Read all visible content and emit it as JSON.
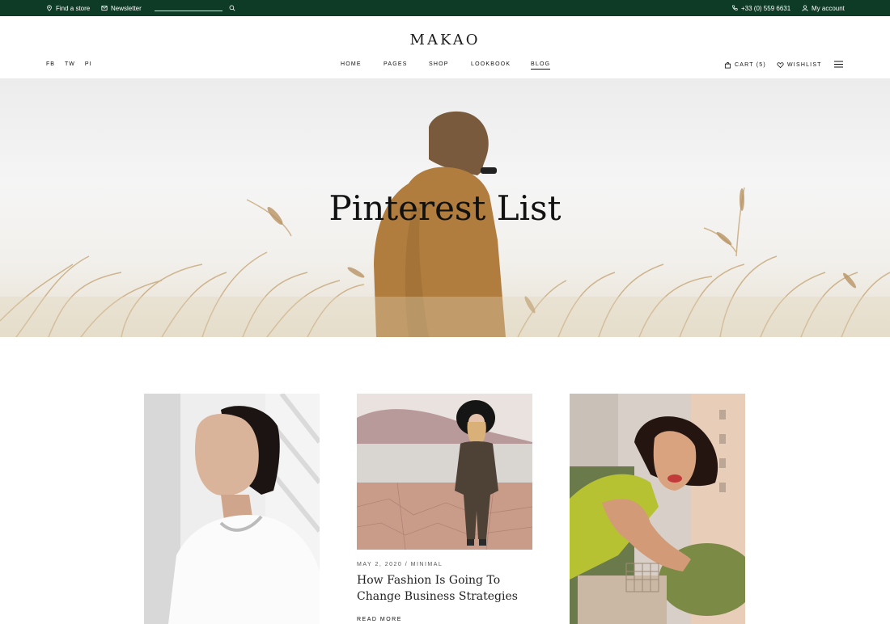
{
  "topbar": {
    "find_store": "Find a store",
    "newsletter": "Newsletter",
    "phone": "+33 (0) 559 6631",
    "account": "My account"
  },
  "header": {
    "logo": "MAKAO",
    "social": [
      "FB",
      "TW",
      "PI"
    ],
    "nav": [
      "HOME",
      "PAGES",
      "SHOP",
      "LOOKBOOK",
      "BLOG"
    ],
    "active_nav": "BLOG",
    "cart": "CART (5)",
    "wishlist": "WISHLIST"
  },
  "hero": {
    "title": "Pinterest List"
  },
  "posts": [
    {
      "image": "woman-white-shirt-necklace"
    },
    {
      "image": "woman-hat-jumpsuit-desert",
      "meta": "MAY 2, 2020 / MINIMAL",
      "title": "How Fashion Is Going To Change Business Strategies",
      "read_more": "READ MORE"
    },
    {
      "image": "woman-curly-hair-balcony"
    }
  ],
  "colors": {
    "topbar": "#0d3b26",
    "text": "#222222"
  },
  "icons": [
    "location-icon",
    "mail-icon",
    "search-icon",
    "phone-icon",
    "user-icon",
    "bag-icon",
    "heart-icon",
    "hamburger-icon"
  ]
}
